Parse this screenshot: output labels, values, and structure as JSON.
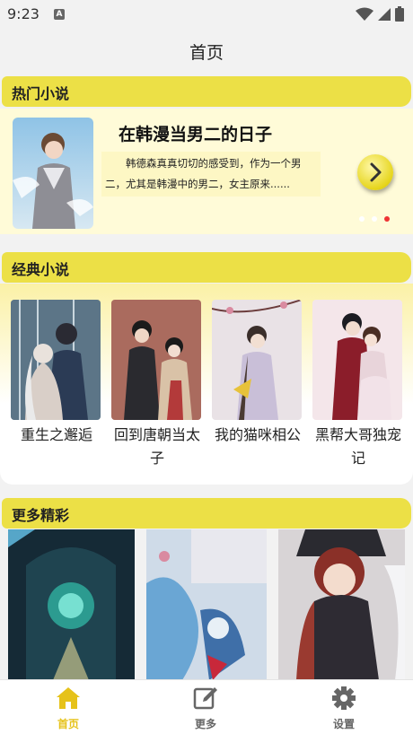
{
  "status": {
    "time": "9:23",
    "notif_badge": "A"
  },
  "header": {
    "title": "首页"
  },
  "hot": {
    "section_title": "热门小说",
    "book_title": "在韩漫当男二的日子",
    "description": "韩德森真真切切的感受到，作为一个男二，尤其是韩漫中的男二，女主原来......"
  },
  "classic": {
    "section_title": "经典小说",
    "books": [
      {
        "name": "重生之邂逅"
      },
      {
        "name": "回到唐朝当太子"
      },
      {
        "name": "我的猫咪相公"
      },
      {
        "name": "黑帮大哥独宠记"
      }
    ]
  },
  "more": {
    "section_title": "更多精彩"
  },
  "nav": {
    "items": [
      {
        "label": "首页",
        "icon": "home-icon",
        "active": true
      },
      {
        "label": "更多",
        "icon": "edit-icon",
        "active": false
      },
      {
        "label": "设置",
        "icon": "gear-icon",
        "active": false
      }
    ]
  },
  "colors": {
    "accent": "#ece046",
    "active_nav": "#e6c21a",
    "inactive_nav": "#666666",
    "dot_active": "#e33333"
  }
}
